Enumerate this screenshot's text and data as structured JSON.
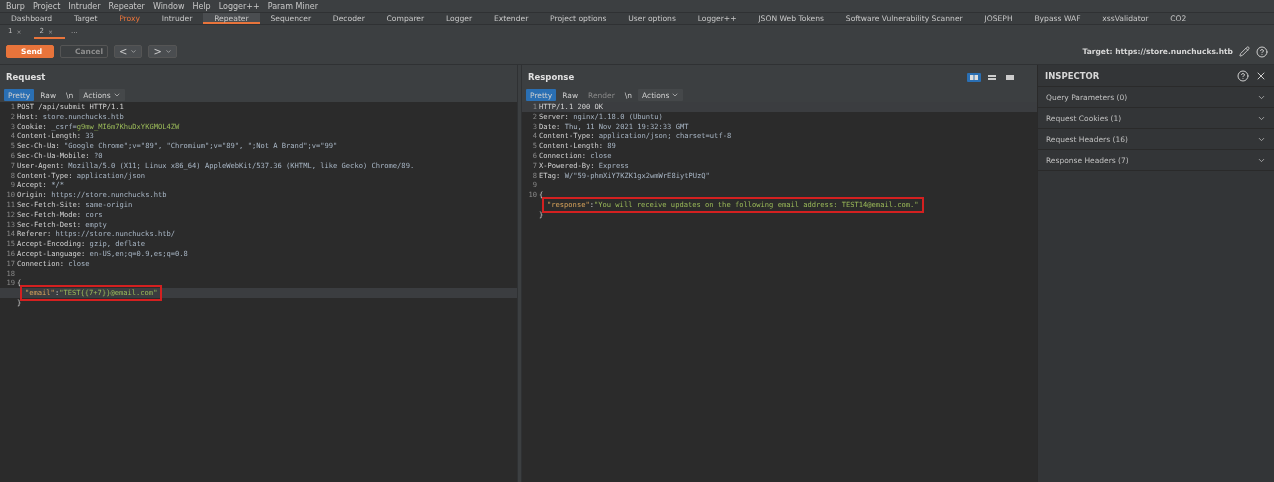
{
  "menu": [
    "Burp",
    "Project",
    "Intruder",
    "Repeater",
    "Window",
    "Help",
    "Logger++",
    "Param Miner"
  ],
  "tools": [
    {
      "label": "Dashboard",
      "selected": false,
      "highlight": false
    },
    {
      "label": "Target",
      "selected": false,
      "highlight": false
    },
    {
      "label": "Proxy",
      "selected": false,
      "highlight": true
    },
    {
      "label": "Intruder",
      "selected": false,
      "highlight": false
    },
    {
      "label": "Repeater",
      "selected": true,
      "highlight": false
    },
    {
      "label": "Sequencer",
      "selected": false,
      "highlight": false
    },
    {
      "label": "Decoder",
      "selected": false,
      "highlight": false
    },
    {
      "label": "Comparer",
      "selected": false,
      "highlight": false
    },
    {
      "label": "Logger",
      "selected": false,
      "highlight": false
    },
    {
      "label": "Extender",
      "selected": false,
      "highlight": false
    },
    {
      "label": "Project options",
      "selected": false,
      "highlight": false
    },
    {
      "label": "User options",
      "selected": false,
      "highlight": false
    },
    {
      "label": "Logger++",
      "selected": false,
      "highlight": false
    },
    {
      "label": "JSON Web Tokens",
      "selected": false,
      "highlight": false
    },
    {
      "label": "Software Vulnerability Scanner",
      "selected": false,
      "highlight": false
    },
    {
      "label": "JOSEPH",
      "selected": false,
      "highlight": false
    },
    {
      "label": "Bypass WAF",
      "selected": false,
      "highlight": false
    },
    {
      "label": "xssValidator",
      "selected": false,
      "highlight": false
    },
    {
      "label": "CO2",
      "selected": false,
      "highlight": false
    }
  ],
  "repeater_tabs": [
    {
      "label": "1",
      "close": "×",
      "selected": false
    },
    {
      "label": "2",
      "close": "×",
      "selected": true
    },
    {
      "label": "...",
      "selected": false
    }
  ],
  "toolbar": {
    "send": "Send",
    "cancel": "Cancel",
    "cancel_disabled": true,
    "back": "<",
    "forward": ">",
    "target": "Target: https://store.nunchucks.htb"
  },
  "request": {
    "title": "Request",
    "views": [
      {
        "label": "Pretty",
        "selected": true,
        "disabled": false
      },
      {
        "label": "Raw",
        "selected": false,
        "disabled": false
      },
      {
        "label": "\\n",
        "selected": false,
        "disabled": false
      }
    ],
    "actions": "Actions",
    "lines": [
      {
        "number": "1",
        "current": false,
        "boxed": false,
        "parts": [
          {
            "kind": "plain",
            "text": "POST /api/submit HTTP/1.1"
          }
        ]
      },
      {
        "number": "2",
        "current": false,
        "boxed": false,
        "parts": [
          {
            "kind": "plain",
            "text": "Host: "
          },
          {
            "kind": "value",
            "text": "store.nunchucks.htb"
          }
        ]
      },
      {
        "number": "3",
        "current": false,
        "boxed": false,
        "parts": [
          {
            "kind": "plain",
            "text": "Cookie: "
          },
          {
            "kind": "value",
            "text": "_csrf="
          },
          {
            "kind": "string",
            "text": "g9mw_MI6m7KhuDxYKGMOL4ZW"
          }
        ]
      },
      {
        "number": "4",
        "current": false,
        "boxed": false,
        "parts": [
          {
            "kind": "plain",
            "text": "Content-Length: "
          },
          {
            "kind": "value",
            "text": "33"
          }
        ]
      },
      {
        "number": "5",
        "current": false,
        "boxed": false,
        "parts": [
          {
            "kind": "plain",
            "text": "Sec-Ch-Ua: "
          },
          {
            "kind": "value",
            "text": "\"Google Chrome\";v=\"89\", \"Chromium\";v=\"89\", \";Not A Brand\";v=\"99\""
          }
        ]
      },
      {
        "number": "6",
        "current": false,
        "boxed": false,
        "parts": [
          {
            "kind": "plain",
            "text": "Sec-Ch-Ua-Mobile: "
          },
          {
            "kind": "value",
            "text": "?0"
          }
        ]
      },
      {
        "number": "7",
        "current": false,
        "boxed": false,
        "parts": [
          {
            "kind": "plain",
            "text": "User-Agent: "
          },
          {
            "kind": "value",
            "text": "Mozilla/5.0 (X11; Linux x86_64) AppleWebKit/537.36 (KHTML, like Gecko) Chrome/89."
          }
        ]
      },
      {
        "number": "8",
        "current": false,
        "boxed": false,
        "parts": [
          {
            "kind": "plain",
            "text": "Content-Type: "
          },
          {
            "kind": "value",
            "text": "application/json"
          }
        ]
      },
      {
        "number": "9",
        "current": false,
        "boxed": false,
        "parts": [
          {
            "kind": "plain",
            "text": "Accept: "
          },
          {
            "kind": "value",
            "text": "*/*"
          }
        ]
      },
      {
        "number": "10",
        "current": false,
        "boxed": false,
        "parts": [
          {
            "kind": "plain",
            "text": "Origin: "
          },
          {
            "kind": "value",
            "text": "https://store.nunchucks.htb"
          }
        ]
      },
      {
        "number": "11",
        "current": false,
        "boxed": false,
        "parts": [
          {
            "kind": "plain",
            "text": "Sec-Fetch-Site: "
          },
          {
            "kind": "value",
            "text": "same-origin"
          }
        ]
      },
      {
        "number": "12",
        "current": false,
        "boxed": false,
        "parts": [
          {
            "kind": "plain",
            "text": "Sec-Fetch-Mode: "
          },
          {
            "kind": "value",
            "text": "cors"
          }
        ]
      },
      {
        "number": "13",
        "current": false,
        "boxed": false,
        "parts": [
          {
            "kind": "plain",
            "text": "Sec-Fetch-Dest: "
          },
          {
            "kind": "value",
            "text": "empty"
          }
        ]
      },
      {
        "number": "14",
        "current": false,
        "boxed": false,
        "parts": [
          {
            "kind": "plain",
            "text": "Referer: "
          },
          {
            "kind": "value",
            "text": "https://store.nunchucks.htb/"
          }
        ]
      },
      {
        "number": "15",
        "current": false,
        "boxed": false,
        "parts": [
          {
            "kind": "plain",
            "text": "Accept-Encoding: "
          },
          {
            "kind": "value",
            "text": "gzip, deflate"
          }
        ]
      },
      {
        "number": "16",
        "current": false,
        "boxed": false,
        "parts": [
          {
            "kind": "plain",
            "text": "Accept-Language: "
          },
          {
            "kind": "value",
            "text": "en-US,en;q=0.9,es;q=0.8"
          }
        ]
      },
      {
        "number": "17",
        "current": false,
        "boxed": false,
        "parts": [
          {
            "kind": "plain",
            "text": "Connection: "
          },
          {
            "kind": "value",
            "text": "close"
          }
        ]
      },
      {
        "number": "18",
        "current": false,
        "boxed": false
      },
      {
        "number": "19",
        "current": false,
        "boxed": false,
        "parts": [
          {
            "kind": "plain",
            "text": "{"
          }
        ]
      },
      {
        "current": true,
        "boxed": true,
        "parts": [
          {
            "kind": "key",
            "text": "\"email\""
          },
          {
            "kind": "plain",
            "text": ":"
          },
          {
            "kind": "string",
            "text": "\"TEST{{7+7}}@email.com\""
          }
        ]
      },
      {
        "current": false,
        "boxed": false,
        "parts": [
          {
            "kind": "plain",
            "text": "}"
          }
        ]
      }
    ]
  },
  "response": {
    "title": "Response",
    "views": [
      {
        "label": "Pretty",
        "selected": true,
        "disabled": false
      },
      {
        "label": "Raw",
        "selected": false,
        "disabled": false
      },
      {
        "label": "Render",
        "selected": false,
        "disabled": true
      },
      {
        "label": "\\n",
        "selected": false,
        "disabled": false
      }
    ],
    "actions": "Actions",
    "layouts": [
      {
        "selected": true
      },
      {
        "selected": false
      },
      {
        "selected": false
      }
    ],
    "lines": [
      {
        "number": "1",
        "current": true,
        "boxed": false,
        "parts": [
          {
            "kind": "plain",
            "text": "HTTP/1.1 200 OK"
          }
        ]
      },
      {
        "number": "2",
        "current": false,
        "boxed": false,
        "parts": [
          {
            "kind": "plain",
            "text": "Server: "
          },
          {
            "kind": "value",
            "text": "nginx/1.18.0 (Ubuntu)"
          }
        ]
      },
      {
        "number": "3",
        "current": false,
        "boxed": false,
        "parts": [
          {
            "kind": "plain",
            "text": "Date: "
          },
          {
            "kind": "value",
            "text": "Thu, 11 Nov 2021 19:32:33 GMT"
          }
        ]
      },
      {
        "number": "4",
        "current": false,
        "boxed": false,
        "parts": [
          {
            "kind": "plain",
            "text": "Content-Type: "
          },
          {
            "kind": "value",
            "text": "application/json; charset=utf-8"
          }
        ]
      },
      {
        "number": "5",
        "current": false,
        "boxed": false,
        "parts": [
          {
            "kind": "plain",
            "text": "Content-Length: "
          },
          {
            "kind": "value",
            "text": "89"
          }
        ]
      },
      {
        "number": "6",
        "current": false,
        "boxed": false,
        "parts": [
          {
            "kind": "plain",
            "text": "Connection: "
          },
          {
            "kind": "value",
            "text": "close"
          }
        ]
      },
      {
        "number": "7",
        "current": false,
        "boxed": false,
        "parts": [
          {
            "kind": "plain",
            "text": "X-Powered-By: "
          },
          {
            "kind": "value",
            "text": "Express"
          }
        ]
      },
      {
        "number": "8",
        "current": false,
        "boxed": false,
        "parts": [
          {
            "kind": "plain",
            "text": "ETag: "
          },
          {
            "kind": "value",
            "text": "W/\"59-phmXiY7KZK1gx2wmWrE8iytPUzQ\""
          }
        ]
      },
      {
        "number": "9",
        "current": false,
        "boxed": false
      },
      {
        "number": "10",
        "current": false,
        "boxed": false,
        "parts": [
          {
            "kind": "plain",
            "text": "{"
          }
        ]
      },
      {
        "current": false,
        "boxed": true,
        "parts": [
          {
            "kind": "key",
            "text": "\"response\""
          },
          {
            "kind": "plain",
            "text": ":"
          },
          {
            "kind": "string",
            "text": "\"You will receive updates on the following email address: TEST14@email.com.\""
          }
        ]
      },
      {
        "current": false,
        "boxed": false,
        "parts": [
          {
            "kind": "plain",
            "text": "}"
          }
        ]
      }
    ]
  },
  "inspector": {
    "title": "INSPECTOR",
    "sections": [
      {
        "label": "Query Parameters (0)",
        "expanded": false
      },
      {
        "label": "Request Cookies (1)",
        "expanded": false
      },
      {
        "label": "Request Headers (16)",
        "expanded": false
      },
      {
        "label": "Response Headers (7)",
        "expanded": false
      }
    ]
  }
}
